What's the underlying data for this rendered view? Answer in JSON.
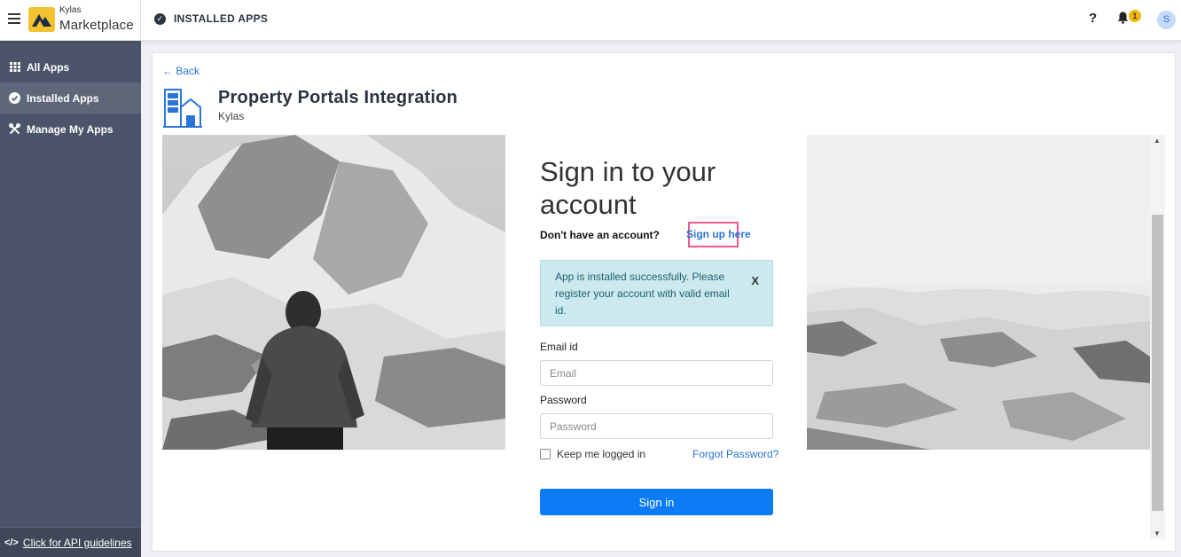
{
  "topbar": {
    "brand_small": "Kylas",
    "brand_big": "Marketplace",
    "page_title": "INSTALLED APPS",
    "help": "?",
    "notification_count": "1",
    "avatar_initial": "S"
  },
  "sidebar": {
    "items": [
      {
        "label": "All Apps",
        "icon": "grid-icon"
      },
      {
        "label": "Installed Apps",
        "icon": "check-circle-icon",
        "active": true
      },
      {
        "label": "Manage My Apps",
        "icon": "tools-icon"
      }
    ],
    "api_prefix": "</>",
    "api_link": "Click for API guidelines"
  },
  "main": {
    "back": "← Back",
    "app_name": "Property Portals Integration",
    "app_vendor": "Kylas"
  },
  "signin": {
    "title": "Sign in to your account",
    "no_account": "Don't have an account?",
    "signup_link": "Sign up here",
    "alert_text": "App is installed successfully. Please register your account with valid email id.",
    "alert_close": "X",
    "email_label": "Email id",
    "email_placeholder": "Email",
    "password_label": "Password",
    "password_placeholder": "Password",
    "remember_label": "Keep me logged in",
    "forgot_link": "Forgot Password?",
    "submit_label": "Sign in"
  },
  "colors": {
    "sidebar_bg": "#4b5469",
    "accent_blue": "#0b7cf5",
    "link_blue": "#2a75d8",
    "highlight_pink": "#ec5a8f",
    "alert_bg": "#cbe9ef",
    "logo_yellow": "#f2c230"
  }
}
